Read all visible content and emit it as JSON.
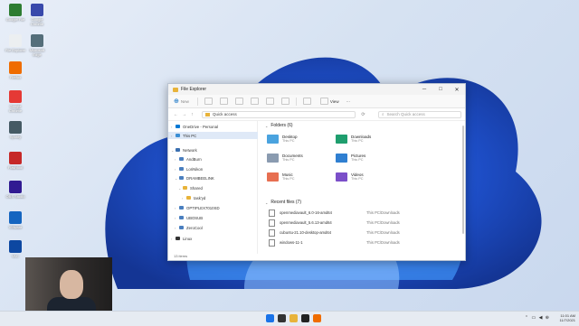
{
  "desktop": {
    "icons": [
      {
        "label": "Google File",
        "color": "#2e7d32"
      },
      {
        "label": "Google Chrome",
        "color": "#3949ab"
      },
      {
        "label": "File Explorer",
        "color": "#eceff1"
      },
      {
        "label": "Microsoft Edge",
        "color": "#546e7a"
      },
      {
        "label": "Firefox",
        "color": "#ef6c00"
      },
      {
        "label": "Google Chrome",
        "color": "#e53935"
      },
      {
        "label": "Spotify",
        "color": "#455a64"
      },
      {
        "label": "Flashtool",
        "color": "#c62828"
      },
      {
        "label": "OBS Studio",
        "color": "#311b92"
      },
      {
        "label": "VMware",
        "color": "#1565c0"
      },
      {
        "label": "VLC",
        "color": "#0d47a1"
      }
    ]
  },
  "window": {
    "title": "File Explorer",
    "controls": {
      "minimize": "─",
      "maximize": "□",
      "close": "✕"
    },
    "commandbar": {
      "new_label": "New",
      "view_label": "View",
      "more_label": "···"
    },
    "address": {
      "back": "←",
      "forward": "→",
      "up": "↑",
      "path": "Quick access",
      "refresh": "⟳",
      "search_placeholder": "Search Quick access"
    },
    "nav_tree": [
      {
        "label": "OneDrive - Personal",
        "icon": "cloud-icon",
        "color": "#0078d4",
        "indent": 0,
        "arrow": "›"
      },
      {
        "label": "This PC",
        "icon": "pc-icon",
        "color": "#3b8ed4",
        "indent": 0,
        "arrow": "›",
        "selected": true
      },
      {
        "label": "Network",
        "icon": "network-icon",
        "color": "#3b6fb0",
        "indent": 0,
        "arrow": "⌄"
      },
      {
        "label": "AndBurn",
        "icon": "computer-icon",
        "color": "#4a7fbf",
        "indent": 1,
        "arrow": "›"
      },
      {
        "label": "LoriNikon",
        "icon": "computer-icon",
        "color": "#4a7fbf",
        "indent": 1,
        "arrow": "›"
      },
      {
        "label": "DRAMBEELINK",
        "icon": "computer-icon",
        "color": "#4a7fbf",
        "indent": 1,
        "arrow": "⌄"
      },
      {
        "label": "Shared",
        "icon": "folder-icon",
        "color": "#e8b33a",
        "indent": 2,
        "arrow": "⌄"
      },
      {
        "label": "task'yd",
        "icon": "folder-icon",
        "color": "#e8b33a",
        "indent": 3,
        "arrow": "›"
      },
      {
        "label": "OPTIPLEX7010SD",
        "icon": "computer-icon",
        "color": "#4a7fbf",
        "indent": 1,
        "arrow": "›"
      },
      {
        "label": "UBOSUB",
        "icon": "computer-icon",
        "color": "#4a7fbf",
        "indent": 1,
        "arrow": "›"
      },
      {
        "label": "ZeroCool",
        "icon": "computer-icon",
        "color": "#4a7fbf",
        "indent": 1,
        "arrow": "›"
      },
      {
        "label": "Linux",
        "icon": "penguin-icon",
        "color": "#333333",
        "indent": 0,
        "arrow": "›"
      }
    ],
    "folders_heading": "Folders (6)",
    "folders": [
      {
        "name": "Desktop",
        "sub": "This PC",
        "color": "#4aa3df"
      },
      {
        "name": "Downloads",
        "sub": "This PC",
        "color": "#1f9e6e"
      },
      {
        "name": "Documents",
        "sub": "This PC",
        "color": "#8a9bb0"
      },
      {
        "name": "Pictures",
        "sub": "This PC",
        "color": "#2f7fd1"
      },
      {
        "name": "Music",
        "sub": "This PC",
        "color": "#e76f51"
      },
      {
        "name": "Videos",
        "sub": "This PC",
        "color": "#7b4fc9"
      }
    ],
    "recent_heading": "Recent files (7)",
    "recent": [
      {
        "name": "openmediavault_6.0-16-amd64",
        "location": "This PC\\Downloads"
      },
      {
        "name": "openmediavault_5.6.13-amd64",
        "location": "This PC\\Downloads"
      },
      {
        "name": "cubuntu-21.10-desktop-amd64",
        "location": "This PC\\Downloads"
      },
      {
        "name": "windows-11-1",
        "location": "This PC\\Downloads"
      }
    ],
    "status": "13 items"
  },
  "taskbar": {
    "apps": [
      {
        "name": "start",
        "color": "#1a73e8"
      },
      {
        "name": "search",
        "color": "#333333"
      },
      {
        "name": "file-explorer",
        "color": "#e8b33a"
      },
      {
        "name": "terminal",
        "color": "#222222"
      },
      {
        "name": "firefox",
        "color": "#ef6c00"
      }
    ],
    "tray_icons": "⌃ ▭ ◀ ⊕",
    "time": "11:01 AM",
    "date": "11/7/2021"
  }
}
